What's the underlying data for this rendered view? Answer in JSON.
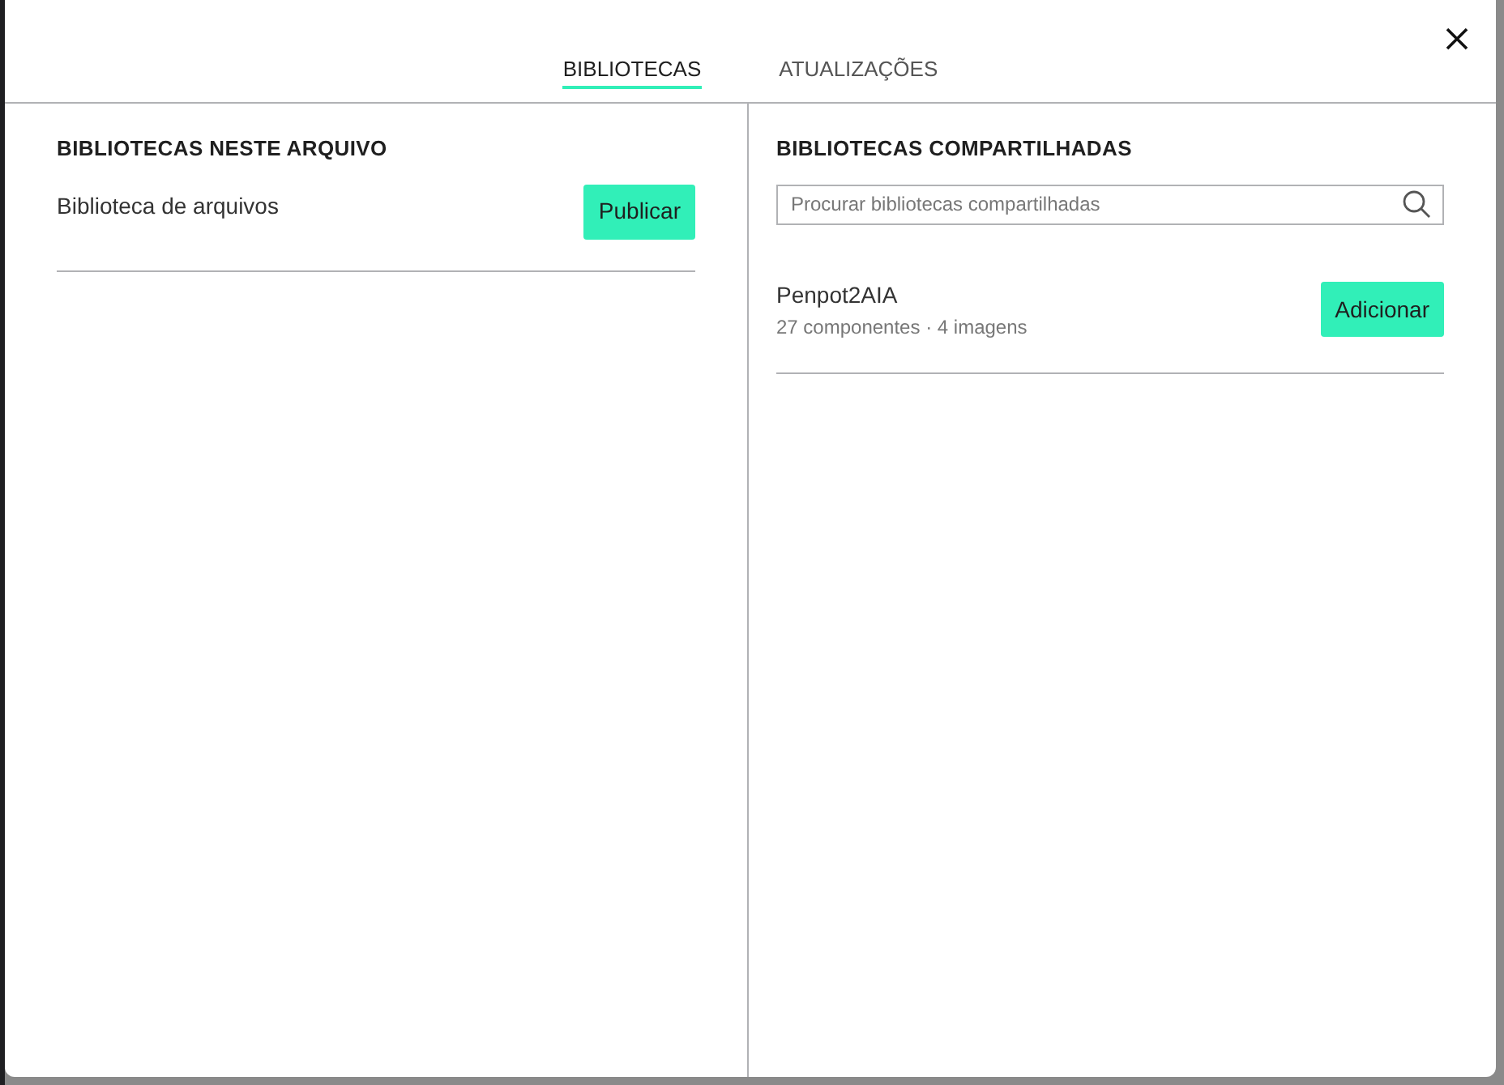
{
  "tabs": [
    {
      "label": "BIBLIOTECAS",
      "selected": true
    },
    {
      "label": "ATUALIZAÇÕES",
      "selected": false
    }
  ],
  "local": {
    "title": "BIBLIOTECAS NESTE ARQUIVO",
    "library_name": "Biblioteca de arquivos",
    "button": "Publicar"
  },
  "shared": {
    "title": "BIBLIOTECAS COMPARTILHADAS",
    "search": {
      "placeholder": "Procurar bibliotecas compartilhadas"
    },
    "libraries": [
      {
        "name": "Penpot2AIA",
        "details": "27 componentes · 4 imagens",
        "button": "Adicionar"
      }
    ]
  }
}
